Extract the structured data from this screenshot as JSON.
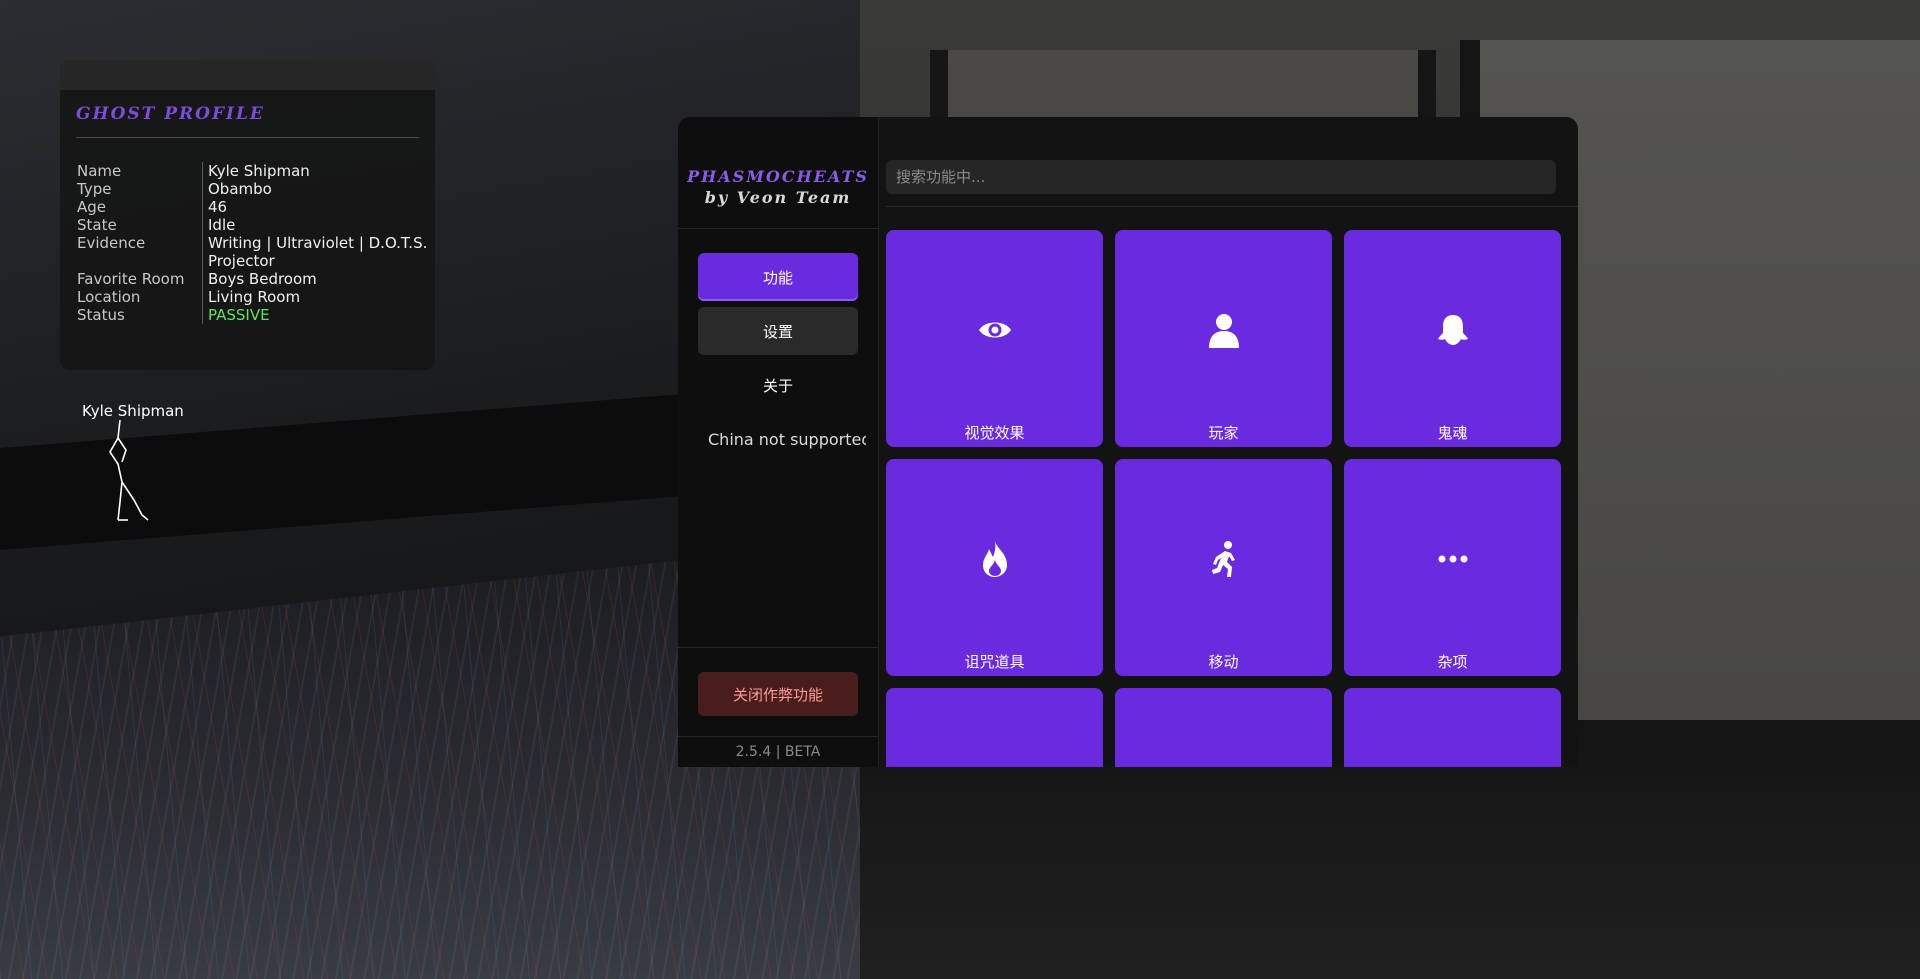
{
  "ghost_profile": {
    "title": "GHOST PROFILE",
    "fields": [
      {
        "key": "Name",
        "value": "Kyle Shipman"
      },
      {
        "key": "Type",
        "value": "Obambo"
      },
      {
        "key": "Age",
        "value": "46"
      },
      {
        "key": "State",
        "value": "Idle"
      },
      {
        "key": "Evidence",
        "value": "Writing | Ultraviolet | D.O.T.S. Projector"
      },
      {
        "key": "Favorite Room",
        "value": "Boys Bedroom"
      },
      {
        "key": "Location",
        "value": "Living Room"
      },
      {
        "key": "Status",
        "value": "PASSIVE"
      }
    ],
    "status_color": "#5fe35f"
  },
  "ghost_world_label": "Kyle Shipman",
  "menu": {
    "brand_line1": "PHASMOCHEATS",
    "brand_line2": "by Veon Team",
    "nav": [
      {
        "label": "功能",
        "state": "active"
      },
      {
        "label": "设置",
        "state": "hover"
      },
      {
        "label": "关于",
        "state": "normal"
      }
    ],
    "note": "China not supported",
    "disable_button": "关闭作弊功能",
    "version": "2.5.4 | BETA",
    "search_placeholder": "搜索功能中...",
    "accent_color": "#6a2be0",
    "tiles": [
      {
        "label": "视觉效果",
        "icon": "eye-icon"
      },
      {
        "label": "玩家",
        "icon": "user-icon"
      },
      {
        "label": "鬼魂",
        "icon": "ghost-icon"
      },
      {
        "label": "诅咒道具",
        "icon": "fire-icon"
      },
      {
        "label": "移动",
        "icon": "running-icon"
      },
      {
        "label": "杂项",
        "icon": "ellipsis-icon"
      },
      {
        "label": "",
        "icon": ""
      },
      {
        "label": "",
        "icon": ""
      },
      {
        "label": "",
        "icon": ""
      }
    ]
  }
}
